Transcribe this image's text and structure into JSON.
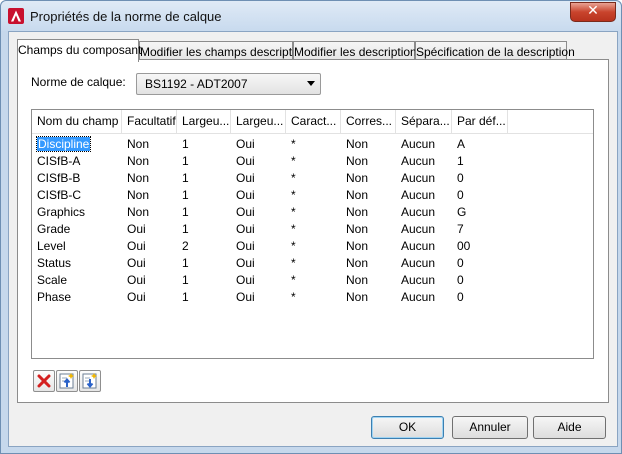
{
  "window": {
    "title": "Propriétés de la norme de calque",
    "close_glyph": "✕",
    "icon": "autocad-app-icon"
  },
  "tabs": [
    {
      "label": "Champs du composant",
      "active": true
    },
    {
      "label": "Modifier les champs descriptifs",
      "active": false
    },
    {
      "label": "Modifier les descriptions",
      "active": false
    },
    {
      "label": "Spécification de la description",
      "active": false
    }
  ],
  "layer_standard": {
    "label": "Norme de calque:",
    "value": "BS1192 - ADT2007"
  },
  "table": {
    "columns": [
      "Nom du champ",
      "Facultatif",
      "Largeu...",
      "Largeu...",
      "Caract...",
      "Corres...",
      "Sépara...",
      "Par déf..."
    ],
    "rows": [
      [
        "Discipline",
        "Non",
        "1",
        "Oui",
        "*",
        "Non",
        "Aucun",
        "A"
      ],
      [
        "CISfB-A",
        "Non",
        "1",
        "Oui",
        "*",
        "Non",
        "Aucun",
        "1"
      ],
      [
        "CISfB-B",
        "Non",
        "1",
        "Oui",
        "*",
        "Non",
        "Aucun",
        "0"
      ],
      [
        "CISfB-C",
        "Non",
        "1",
        "Oui",
        "*",
        "Non",
        "Aucun",
        "0"
      ],
      [
        "Graphics",
        "Non",
        "1",
        "Oui",
        "*",
        "Non",
        "Aucun",
        "G"
      ],
      [
        "Grade",
        "Oui",
        "1",
        "Oui",
        "*",
        "Non",
        "Aucun",
        "7"
      ],
      [
        "Level",
        "Oui",
        "2",
        "Oui",
        "*",
        "Non",
        "Aucun",
        "00"
      ],
      [
        "Status",
        "Oui",
        "1",
        "Oui",
        "*",
        "Non",
        "Aucun",
        "0"
      ],
      [
        "Scale",
        "Oui",
        "1",
        "Oui",
        "*",
        "Non",
        "Aucun",
        "0"
      ],
      [
        "Phase",
        "Oui",
        "1",
        "Oui",
        "*",
        "Non",
        "Aucun",
        "0"
      ]
    ],
    "selected_row": 0
  },
  "icon_buttons": [
    {
      "name": "delete-field-icon"
    },
    {
      "name": "move-up-icon"
    },
    {
      "name": "move-down-icon"
    }
  ],
  "buttons": {
    "ok": "OK",
    "cancel": "Annuler",
    "help": "Aide"
  },
  "colors": {
    "selection": "#3399ff",
    "delete_red": "#d42020",
    "arrow_blue": "#2a62c9"
  }
}
